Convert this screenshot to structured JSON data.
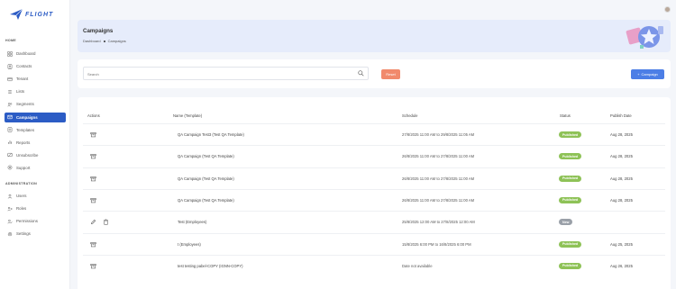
{
  "brand": {
    "name": "FLIGHT"
  },
  "sidebar": {
    "home_label": "HOME",
    "admin_label": "ADMINISTRATION",
    "items": [
      {
        "label": "Dashboard",
        "icon": "dashboard-icon"
      },
      {
        "label": "Contacts",
        "icon": "contacts-icon"
      },
      {
        "label": "Tenant",
        "icon": "tenant-icon"
      },
      {
        "label": "Lists",
        "icon": "lists-icon"
      },
      {
        "label": "Segments",
        "icon": "segments-icon"
      },
      {
        "label": "Campaigns",
        "icon": "campaigns-icon",
        "active": true
      },
      {
        "label": "Templates",
        "icon": "templates-icon"
      },
      {
        "label": "Reports",
        "icon": "reports-icon"
      },
      {
        "label": "Unsubscribe",
        "icon": "unsubscribe-icon"
      },
      {
        "label": "Support",
        "icon": "support-icon"
      }
    ],
    "admin_items": [
      {
        "label": "Users",
        "icon": "users-icon"
      },
      {
        "label": "Roles",
        "icon": "roles-icon"
      },
      {
        "label": "Permissions",
        "icon": "permissions-icon"
      },
      {
        "label": "Settings",
        "icon": "settings-icon"
      }
    ]
  },
  "header": {
    "title": "Campaigns",
    "breadcrumb": [
      "Dashboard",
      "Campaigns"
    ]
  },
  "filters": {
    "search_placeholder": "Search",
    "reset_label": "Reset",
    "add_label": "Campaign"
  },
  "table": {
    "columns": [
      "Actions",
      "Name (Template)",
      "Schedule",
      "Status",
      "Publish Date"
    ],
    "rows": [
      {
        "actions": [
          "archive"
        ],
        "name": "QA Campaign Test3 (Test QA Template)",
        "schedule": "27/8/2025 11:00 AM to 29/8/2025 11:05 AM",
        "status": "Published",
        "publish_date": "Aug 28, 2025"
      },
      {
        "actions": [
          "archive"
        ],
        "name": "QA Campaign (Test QA Template)",
        "schedule": "26/8/2025 11:00 AM to 27/8/2025 11:00 AM",
        "status": "Published",
        "publish_date": "Aug 28, 2025"
      },
      {
        "actions": [
          "archive"
        ],
        "name": "QA Campaign (Test QA Template)",
        "schedule": "26/8/2025 11:00 AM to 27/8/2025 11:00 AM",
        "status": "Published",
        "publish_date": "Aug 28, 2025"
      },
      {
        "actions": [
          "archive"
        ],
        "name": "QA Campaign (Test QA Template)",
        "schedule": "26/8/2025 11:00 AM to 27/8/2025 11:00 AM",
        "status": "Published",
        "publish_date": "Aug 28, 2025"
      },
      {
        "actions": [
          "edit",
          "delete"
        ],
        "name": "Test (Employees)",
        "schedule": "25/8/2025 12:00 AM to 27/8/2025 12:00 AM",
        "status": "New",
        "publish_date": ""
      },
      {
        "actions": [
          "archive"
        ],
        "name": "t (Employees)",
        "schedule": "15/8/2025 6:00 PM to 16/8/2025 6:00 PM",
        "status": "Published",
        "publish_date": "Aug 25, 2025"
      },
      {
        "actions": [
          "archive"
        ],
        "name": "test testing pabel-COPY (IGNN-COPY)",
        "schedule": "Date not available",
        "status": "Published",
        "publish_date": "Aug 26, 2025"
      }
    ]
  },
  "colors": {
    "primary": "#2c5cc5",
    "published": "#8ec257",
    "new": "#9aa0a8",
    "reset": "#f18a6c",
    "add": "#4c7ee6"
  }
}
